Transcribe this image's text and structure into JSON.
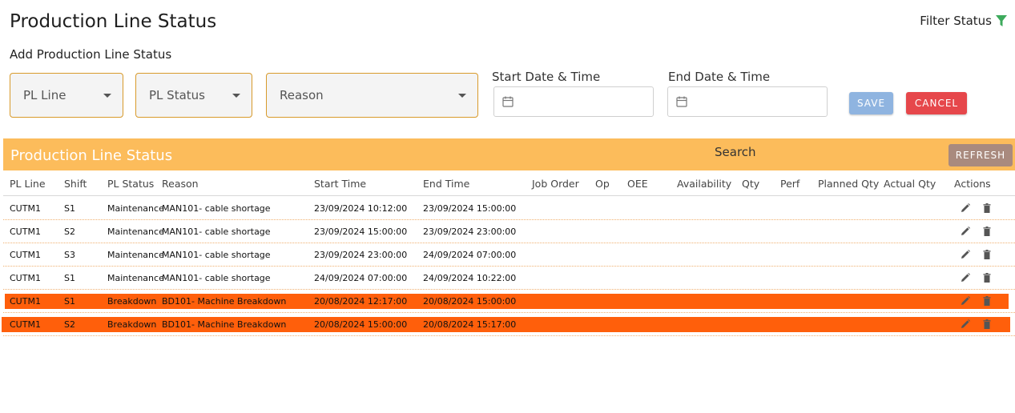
{
  "header": {
    "title": "Production Line Status",
    "filter_label": "Filter Status",
    "subtitle": "Add Production Line Status"
  },
  "form": {
    "pl_line_label": "PL Line",
    "pl_status_label": "PL Status",
    "reason_label": "Reason",
    "start_label": "Start Date & Time",
    "end_label": "End Date & Time",
    "save_label": "SAVE",
    "cancel_label": "CANCEL"
  },
  "table_bar": {
    "title": "Production Line Status",
    "search_label": "Search",
    "refresh_label": "REFRESH"
  },
  "columns": [
    "PL Line",
    "Shift",
    "PL Status",
    "Reason",
    "Start Time",
    "End Time",
    "Job Order",
    "Op",
    "OEE",
    "Availability",
    "Qty",
    "Perf",
    "Planned Qty",
    "Actual Qty",
    "Actions"
  ],
  "rows": [
    {
      "pl_line": "CUTM1",
      "shift": "S1",
      "status": "Maintenance",
      "reason": "MAN101- cable shortage",
      "start": "23/09/2024 10:12:00",
      "end": "23/09/2024 15:00:00",
      "highlight": false
    },
    {
      "pl_line": "CUTM1",
      "shift": "S2",
      "status": "Maintenance",
      "reason": "MAN101- cable shortage",
      "start": "23/09/2024 15:00:00",
      "end": "23/09/2024 23:00:00",
      "highlight": false
    },
    {
      "pl_line": "CUTM1",
      "shift": "S3",
      "status": "Maintenance",
      "reason": "MAN101- cable shortage",
      "start": "23/09/2024 23:00:00",
      "end": "24/09/2024 07:00:00",
      "highlight": false
    },
    {
      "pl_line": "CUTM1",
      "shift": "S1",
      "status": "Maintenance",
      "reason": "MAN101- cable shortage",
      "start": "24/09/2024 07:00:00",
      "end": "24/09/2024 10:22:00",
      "highlight": false
    },
    {
      "pl_line": "CUTM1",
      "shift": "S1",
      "status": "Breakdown",
      "reason": "BD101- Machine Breakdown",
      "start": "20/08/2024 12:17:00",
      "end": "20/08/2024 15:00:00",
      "highlight": true
    },
    {
      "pl_line": "CUTM1",
      "shift": "S2",
      "status": "Breakdown",
      "reason": "BD101- Machine Breakdown",
      "start": "20/08/2024 15:00:00",
      "end": "20/08/2024 15:17:00",
      "highlight": true
    }
  ],
  "colors": {
    "accent_bar": "#fcbc5b",
    "highlight_row": "#ff5f0b",
    "save_button": "#8fb4e0",
    "cancel_button": "#e6474b",
    "refresh_button": "#a98a7e",
    "filter_icon": "#3daa5c",
    "select_border": "#d89a2b"
  },
  "icons": {
    "filter": "funnel-icon",
    "dropdown": "chevron-down-icon",
    "date": "calendar-icon",
    "edit": "pencil-icon",
    "delete": "trash-icon"
  }
}
